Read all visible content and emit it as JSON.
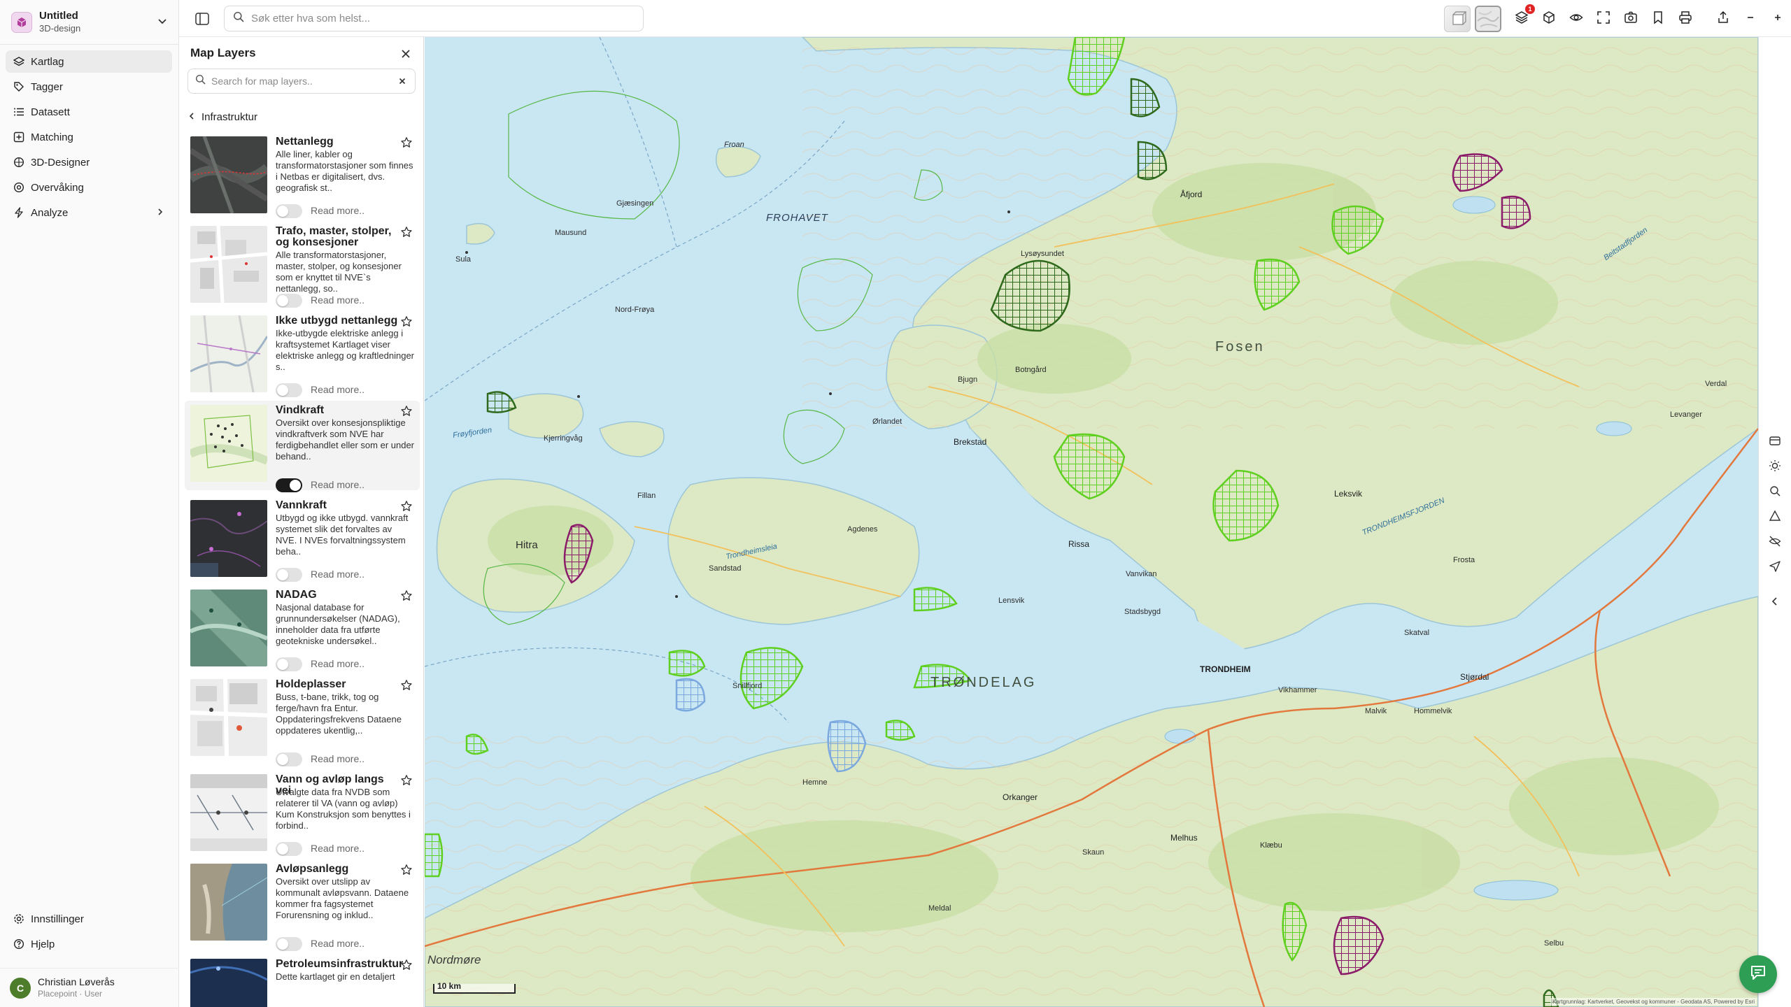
{
  "project": {
    "name": "Untitled",
    "subtitle": "3D-design"
  },
  "nav": {
    "items": [
      {
        "label": "Kartlag",
        "icon": "layers-icon",
        "active": true
      },
      {
        "label": "Tagger",
        "icon": "tag-icon",
        "active": false
      },
      {
        "label": "Datasett",
        "icon": "list-icon",
        "active": false
      },
      {
        "label": "Matching",
        "icon": "match-icon",
        "active": false
      },
      {
        "label": "3D-Designer",
        "icon": "cube-icon",
        "active": false
      },
      {
        "label": "Overvåking",
        "icon": "monitor-icon",
        "active": false
      },
      {
        "label": "Analyze",
        "icon": "bolt-icon",
        "active": false
      }
    ],
    "bottom": [
      {
        "label": "Innstillinger",
        "icon": "gear-icon"
      },
      {
        "label": "Hjelp",
        "icon": "help-icon"
      }
    ]
  },
  "user": {
    "initial": "C",
    "name": "Christian Løverås",
    "role": "Placepoint · User"
  },
  "topbar": {
    "search_placeholder": "Søk etter hva som helst...",
    "layers_badge": "1",
    "buttons": [
      "sidebar-toggle-icon",
      "basemap-3d",
      "basemap-map",
      "layers-icon",
      "cube-icon",
      "eye-icon",
      "fullscreen-icon",
      "camera-icon",
      "bookmark-icon",
      "print-icon",
      "share-icon",
      "zoom-out-icon",
      "zoom-in-icon"
    ]
  },
  "panel": {
    "title": "Map Layers",
    "search_placeholder": "Search for map layers..",
    "breadcrumb": "Infrastruktur",
    "read_more": "Read more..",
    "layers": [
      {
        "title": "Nettanlegg",
        "description": "Alle liner, kabler og transformatorstasjoner som finnes i Netbas er digitalisert, dvs. geografisk st..",
        "enabled": false
      },
      {
        "title": "Trafo, master, stolper, og konsesjoner",
        "description": "Alle transformatorstasjoner, master, stolper, og konsesjoner som er knyttet til NVE`s nettanlegg, so..",
        "enabled": false
      },
      {
        "title": "Ikke utbygd nettanlegg",
        "description": "Ikke-utbygde elektriske anlegg i kraftsystemet Kartlaget viser elektriske anlegg og kraftledninger s..",
        "enabled": false
      },
      {
        "title": "Vindkraft",
        "description": "Oversikt over konsesjonspliktige vindkraftverk som NVE har ferdigbehandlet eller som er under behand..",
        "enabled": true
      },
      {
        "title": "Vannkraft",
        "description": "Utbygd og ikke utbygd. vannkraft systemet slik det forvaltes av NVE. I NVEs forvaltningssystem beha..",
        "enabled": false
      },
      {
        "title": "NADAG",
        "description": "Nasjonal database for grunnundersøkelser (NADAG), inneholder data fra utførte geotekniske undersøkel..",
        "enabled": false
      },
      {
        "title": "Holdeplasser",
        "description": "Buss, t-bane, trikk, tog og ferge/havn fra Entur. Oppdateringsfrekvens Dataene oppdateres ukentlig,..",
        "enabled": false
      },
      {
        "title": "Vann og avløp langs vei",
        "description": "Utvalgte data fra NVDB som relaterer til VA (vann og avløp) Kum Konstruksjon som benyttes i forbind..",
        "enabled": false
      },
      {
        "title": "Avløpsanlegg",
        "description": "Oversikt over utslipp av kommunalt avløpsvann. Dataene kommer fra fagsystemet Forurensning og inklud..",
        "enabled": false
      },
      {
        "title": "Petroleumsinfrastruktur",
        "description": "Dette kartlaget gir en detaljert",
        "enabled": false
      }
    ]
  },
  "map": {
    "scale_label": "10 km",
    "attribution": "Kartgrunnlag: Kartverket, Geovekst og kommuner - Geodata AS, Powered by Esri",
    "labels": {
      "frohavet": "FROHAVET",
      "fosen": "Fosen",
      "trondelag": "TRØNDELAG",
      "trondheim": "TRONDHEIM",
      "trondheimsfjorden": "TRONDHEIMSFJORDEN",
      "trondheimsleia": "Trondheimsleia",
      "froyfjorden": "Frøyfjorden",
      "hitra": "Hitra",
      "froan": "Froan",
      "orlandet": "Ørlandet",
      "brekstad": "Brekstad",
      "leksvik": "Leksvik",
      "rissa": "Rissa",
      "stjordal": "Stjørdal",
      "orkanger": "Orkanger",
      "melhus": "Melhus",
      "klaebu": "Klæbu",
      "afjord": "Åfjord",
      "fillan": "Fillan",
      "sandstad": "Sandstad",
      "vikhammer": "Vikhammer",
      "malvik": "Malvik",
      "selbu": "Selbu",
      "levanger": "Levanger",
      "verdal": "Verdal",
      "frosta": "Frosta",
      "skaun": "Skaun",
      "meldal": "Meldal",
      "hemne": "Hemne",
      "lensvik": "Lensvik",
      "agdenes": "Agdenes",
      "snillfjord": "Snillfjord",
      "stadsbygd": "Stadsbygd",
      "vanvikan": "Vanvikan",
      "hommelvik": "Hommelvik",
      "meraker": "Skatval",
      "beitstadfjorden": "Beitstadfjorden",
      "sula": "Sula",
      "mausund": "Mausund",
      "halten": "Gjæsingen",
      "kjerringvag": "Kjerringvåg",
      "nordfroya": "Nord-Frøya",
      "lysoysund": "Lysøysundet",
      "bjugn": "Bjugn",
      "botngard": "Botngård",
      "nordmore": "Nordmøre"
    }
  }
}
